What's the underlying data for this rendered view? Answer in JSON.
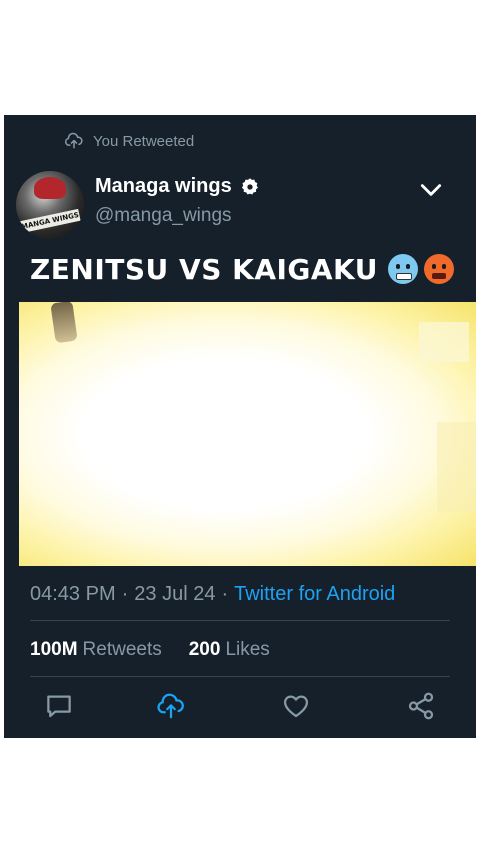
{
  "retweet": {
    "label": "You Retweeted",
    "icon": "retweet-icon"
  },
  "author": {
    "name": "Managa wings",
    "handle": "@manga_wings",
    "avatar_text": "MANGA WINGS",
    "verified": true
  },
  "tweet": {
    "text": "ZENITSU VS KAIGAKU",
    "emojis": [
      "cold-face-emoji",
      "hot-face-emoji"
    ]
  },
  "meta": {
    "time": "04:43 PM",
    "separator": "·",
    "date": "23 Jul 24",
    "client": "Twitter for Android"
  },
  "stats": {
    "retweets_count": "100M",
    "retweets_label": "Retweets",
    "likes_count": "200",
    "likes_label": "Likes"
  },
  "actions": [
    "reply-icon",
    "retweet-icon",
    "like-icon",
    "share-icon"
  ],
  "colors": {
    "background": "#15202b",
    "accent": "#1da1f2",
    "muted": "#8899a6",
    "text": "#ffffff",
    "divider": "#38444d"
  }
}
